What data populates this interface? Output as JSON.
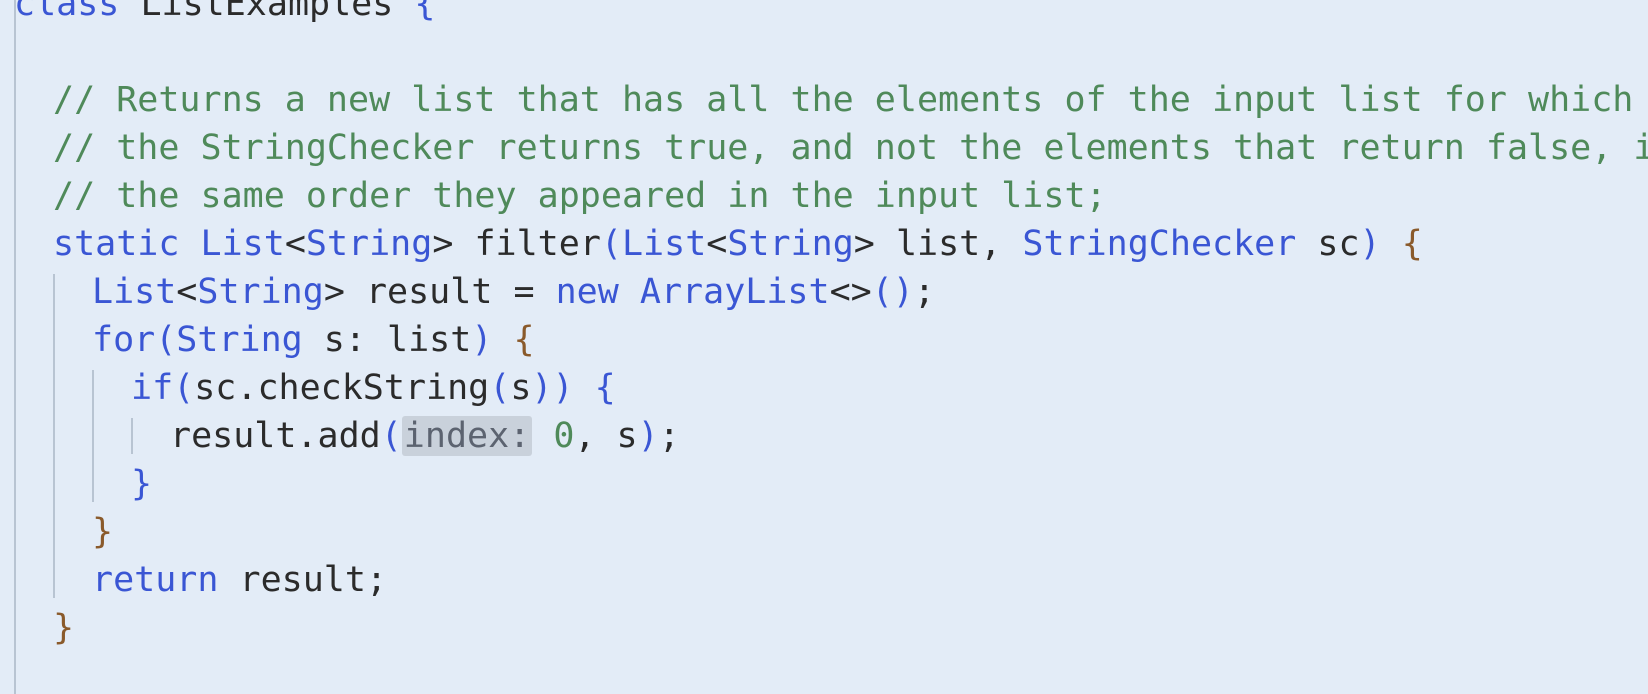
{
  "editor": {
    "lines": [
      {
        "indent": 0,
        "tokens": [
          {
            "text": "class ",
            "cls": "t-kw"
          },
          {
            "text": "ListExamples ",
            "cls": "t-plain"
          },
          {
            "text": "{",
            "cls": "t-brace-b"
          }
        ]
      },
      {
        "indent": 0,
        "tokens": []
      },
      {
        "indent": 1,
        "tokens": [
          {
            "text": "// Returns a new list that has all the elements of the input list for which",
            "cls": "t-comment"
          }
        ]
      },
      {
        "indent": 1,
        "tokens": [
          {
            "text": "// the StringChecker returns true, and not the elements that return false, in",
            "cls": "t-comment"
          }
        ]
      },
      {
        "indent": 1,
        "tokens": [
          {
            "text": "// the same order they appeared in the input list;",
            "cls": "t-comment"
          }
        ]
      },
      {
        "indent": 1,
        "tokens": [
          {
            "text": "static ",
            "cls": "t-kw"
          },
          {
            "text": "List",
            "cls": "t-type"
          },
          {
            "text": "<",
            "cls": "t-punct"
          },
          {
            "text": "String",
            "cls": "t-type"
          },
          {
            "text": "> filter",
            "cls": "t-plain"
          },
          {
            "text": "(",
            "cls": "t-paren"
          },
          {
            "text": "List",
            "cls": "t-type"
          },
          {
            "text": "<",
            "cls": "t-punct"
          },
          {
            "text": "String",
            "cls": "t-type"
          },
          {
            "text": "> list, ",
            "cls": "t-plain"
          },
          {
            "text": "StringChecker",
            "cls": "t-type"
          },
          {
            "text": " sc",
            "cls": "t-plain"
          },
          {
            "text": ")",
            "cls": "t-paren"
          },
          {
            "text": " ",
            "cls": "t-plain"
          },
          {
            "text": "{",
            "cls": "t-brace-a"
          }
        ]
      },
      {
        "indent": 2,
        "tokens": [
          {
            "text": "List",
            "cls": "t-type"
          },
          {
            "text": "<",
            "cls": "t-punct"
          },
          {
            "text": "String",
            "cls": "t-type"
          },
          {
            "text": "> result = ",
            "cls": "t-plain"
          },
          {
            "text": "new ",
            "cls": "t-kw"
          },
          {
            "text": "ArrayList",
            "cls": "t-type"
          },
          {
            "text": "<>",
            "cls": "t-punct"
          },
          {
            "text": "()",
            "cls": "t-paren"
          },
          {
            "text": ";",
            "cls": "t-punct"
          }
        ]
      },
      {
        "indent": 2,
        "tokens": [
          {
            "text": "for",
            "cls": "t-kw"
          },
          {
            "text": "(",
            "cls": "t-paren"
          },
          {
            "text": "String",
            "cls": "t-type"
          },
          {
            "text": " s: list",
            "cls": "t-plain"
          },
          {
            "text": ")",
            "cls": "t-paren"
          },
          {
            "text": " ",
            "cls": "t-plain"
          },
          {
            "text": "{",
            "cls": "t-brace-a"
          }
        ]
      },
      {
        "indent": 3,
        "tokens": [
          {
            "text": "if",
            "cls": "t-kw"
          },
          {
            "text": "(",
            "cls": "t-paren"
          },
          {
            "text": "sc.checkString",
            "cls": "t-plain"
          },
          {
            "text": "(",
            "cls": "t-paren"
          },
          {
            "text": "s",
            "cls": "t-plain"
          },
          {
            "text": "))",
            "cls": "t-paren"
          },
          {
            "text": " ",
            "cls": "t-plain"
          },
          {
            "text": "{",
            "cls": "t-brace-b"
          }
        ]
      },
      {
        "indent": 4,
        "tokens": [
          {
            "text": "result.add",
            "cls": "t-plain"
          },
          {
            "text": "(",
            "cls": "t-paren"
          },
          {
            "text": "index:",
            "cls": "inlay-hint"
          },
          {
            "text": " ",
            "cls": "t-plain"
          },
          {
            "text": "0",
            "cls": "t-num"
          },
          {
            "text": ", s",
            "cls": "t-plain"
          },
          {
            "text": ")",
            "cls": "t-paren"
          },
          {
            "text": ";",
            "cls": "t-punct"
          }
        ]
      },
      {
        "indent": 3,
        "tokens": [
          {
            "text": "}",
            "cls": "t-brace-b"
          }
        ]
      },
      {
        "indent": 2,
        "tokens": [
          {
            "text": "}",
            "cls": "t-brace-a"
          }
        ]
      },
      {
        "indent": 2,
        "tokens": [
          {
            "text": "return ",
            "cls": "t-kw"
          },
          {
            "text": "result;",
            "cls": "t-plain"
          }
        ]
      },
      {
        "indent": 1,
        "tokens": [
          {
            "text": "}",
            "cls": "t-brace-a"
          }
        ]
      }
    ]
  }
}
